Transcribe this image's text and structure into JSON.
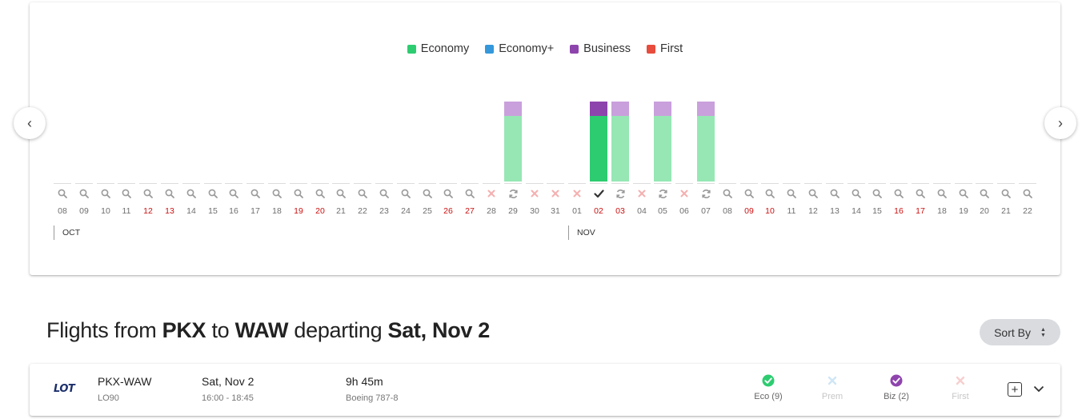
{
  "legend": [
    {
      "label": "Economy",
      "color": "#2ecc71"
    },
    {
      "label": "Economy+",
      "color": "#3498db"
    },
    {
      "label": "Business",
      "color": "#8e44ad"
    },
    {
      "label": "First",
      "color": "#e74c3c"
    }
  ],
  "calendar": {
    "nav": {
      "prev": "‹",
      "next": "›"
    },
    "months": [
      "OCT",
      "NOV"
    ],
    "columns": [
      {
        "day": "08",
        "status": "search",
        "weekend": false
      },
      {
        "day": "09",
        "status": "search",
        "weekend": false
      },
      {
        "day": "10",
        "status": "search",
        "weekend": false
      },
      {
        "day": "11",
        "status": "search",
        "weekend": false
      },
      {
        "day": "12",
        "status": "search",
        "weekend": true
      },
      {
        "day": "13",
        "status": "search",
        "weekend": true
      },
      {
        "day": "14",
        "status": "search",
        "weekend": false
      },
      {
        "day": "15",
        "status": "search",
        "weekend": false
      },
      {
        "day": "16",
        "status": "search",
        "weekend": false
      },
      {
        "day": "17",
        "status": "search",
        "weekend": false
      },
      {
        "day": "18",
        "status": "search",
        "weekend": false
      },
      {
        "day": "19",
        "status": "search",
        "weekend": true
      },
      {
        "day": "20",
        "status": "search",
        "weekend": true
      },
      {
        "day": "21",
        "status": "search",
        "weekend": false
      },
      {
        "day": "22",
        "status": "search",
        "weekend": false
      },
      {
        "day": "23",
        "status": "search",
        "weekend": false
      },
      {
        "day": "24",
        "status": "search",
        "weekend": false
      },
      {
        "day": "25",
        "status": "search",
        "weekend": false
      },
      {
        "day": "26",
        "status": "search",
        "weekend": true
      },
      {
        "day": "27",
        "status": "search",
        "weekend": true
      },
      {
        "day": "28",
        "status": "none",
        "weekend": false
      },
      {
        "day": "29",
        "status": "refresh",
        "weekend": false,
        "economy": "light",
        "business": "light"
      },
      {
        "day": "30",
        "status": "none",
        "weekend": false
      },
      {
        "day": "31",
        "status": "none",
        "weekend": false
      },
      {
        "day": "01",
        "status": "none",
        "weekend": false
      },
      {
        "day": "02",
        "status": "selected",
        "weekend": true,
        "economy": "dark",
        "business": "dark"
      },
      {
        "day": "03",
        "status": "refresh",
        "weekend": true,
        "economy": "light",
        "business": "light"
      },
      {
        "day": "04",
        "status": "none",
        "weekend": false
      },
      {
        "day": "05",
        "status": "refresh",
        "weekend": false,
        "economy": "light",
        "business": "light"
      },
      {
        "day": "06",
        "status": "none",
        "weekend": false
      },
      {
        "day": "07",
        "status": "refresh",
        "weekend": false,
        "economy": "light",
        "business": "light"
      },
      {
        "day": "08",
        "status": "search",
        "weekend": false
      },
      {
        "day": "09",
        "status": "search",
        "weekend": true
      },
      {
        "day": "10",
        "status": "search",
        "weekend": true
      },
      {
        "day": "11",
        "status": "search",
        "weekend": false
      },
      {
        "day": "12",
        "status": "search",
        "weekend": false
      },
      {
        "day": "13",
        "status": "search",
        "weekend": false
      },
      {
        "day": "14",
        "status": "search",
        "weekend": false
      },
      {
        "day": "15",
        "status": "search",
        "weekend": false
      },
      {
        "day": "16",
        "status": "search",
        "weekend": true
      },
      {
        "day": "17",
        "status": "search",
        "weekend": true
      },
      {
        "day": "18",
        "status": "search",
        "weekend": false
      },
      {
        "day": "19",
        "status": "search",
        "weekend": false
      },
      {
        "day": "20",
        "status": "search",
        "weekend": false
      },
      {
        "day": "21",
        "status": "search",
        "weekend": false
      },
      {
        "day": "22",
        "status": "search",
        "weekend": false
      }
    ]
  },
  "results": {
    "prefix": "Flights from",
    "origin": "PKX",
    "to_word": "to",
    "destination": "WAW",
    "departing_word": "departing",
    "date": "Sat, Nov 2",
    "sort_label": "Sort By"
  },
  "flight": {
    "airline_logo_text": "LOT",
    "route": "PKX-WAW",
    "flight_number": "LO90",
    "date": "Sat, Nov 2",
    "times": "16:00 - 18:45",
    "duration": "9h 45m",
    "aircraft": "Boeing 787-8",
    "cabins": [
      {
        "label": "Eco (9)",
        "available": true,
        "color": "#2ecc71"
      },
      {
        "label": "Prem",
        "available": false,
        "color": "#3498db"
      },
      {
        "label": "Biz (2)",
        "available": true,
        "color": "#8e44ad"
      },
      {
        "label": "First",
        "available": false,
        "color": "#e74c3c"
      }
    ]
  }
}
